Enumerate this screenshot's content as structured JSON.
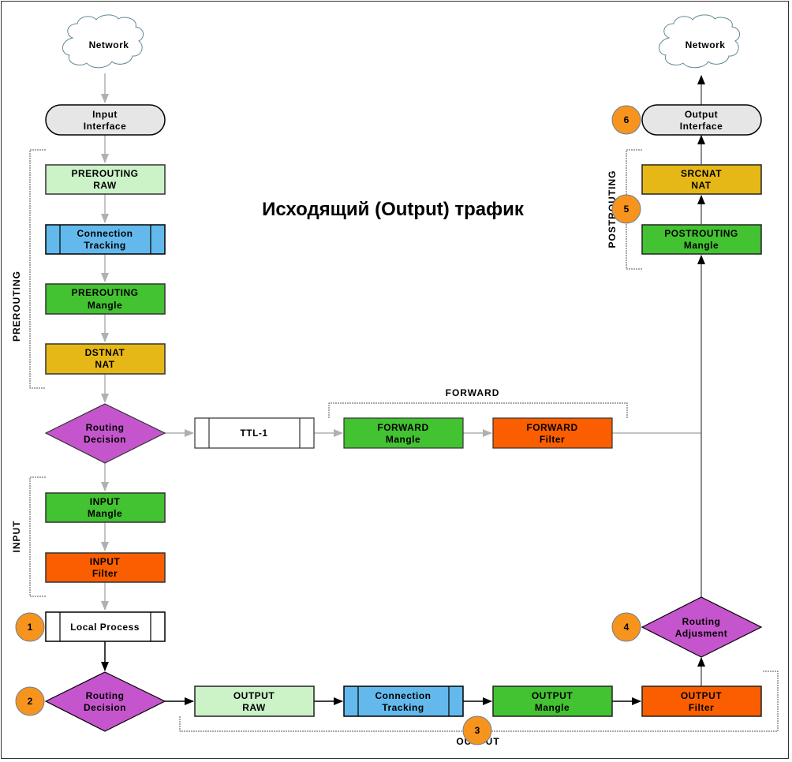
{
  "title": "Исходящий (Output) трафик",
  "colors": {
    "raw": "#ccf2c8",
    "conntrack": "#63b9ec",
    "mangle": "#43c232",
    "nat": "#e6b817",
    "filter": "#fb5e00",
    "decision": "#c555cc",
    "interface": "#e6e6e6",
    "badge": "#f7941d",
    "plain": "#ffffff",
    "arrow_gray": "#b0b0b0",
    "arrow_black": "#000000"
  },
  "groups": {
    "prerouting": "PREROUTING",
    "input": "INPUT",
    "forward": "FORWARD",
    "output": "OUTPUT",
    "postrouting": "POSTROUTING"
  },
  "nodes": {
    "network_in": "Network",
    "input_interface": [
      "Input",
      "Interface"
    ],
    "prerouting_raw": [
      "PREROUTING",
      "RAW"
    ],
    "conntrack_pre": [
      "Connection",
      "Tracking"
    ],
    "prerouting_mangle": [
      "PREROUTING",
      "Mangle"
    ],
    "dstnat": [
      "DSTNAT",
      "NAT"
    ],
    "routing_decision_1": [
      "Routing",
      "Decision"
    ],
    "ttl": "TTL-1",
    "forward_mangle": [
      "FORWARD",
      "Mangle"
    ],
    "forward_filter": [
      "FORWARD",
      "Filter"
    ],
    "input_mangle": [
      "INPUT",
      "Mangle"
    ],
    "input_filter": [
      "INPUT",
      "Filter"
    ],
    "local_process": "Local Process",
    "routing_decision_2": [
      "Routing",
      "Decision"
    ],
    "output_raw": [
      "OUTPUT",
      "RAW"
    ],
    "conntrack_out": [
      "Connection",
      "Tracking"
    ],
    "output_mangle": [
      "OUTPUT",
      "Mangle"
    ],
    "output_filter": [
      "OUTPUT",
      "Filter"
    ],
    "routing_adjustment": [
      "Routing",
      "Adjusment"
    ],
    "postrouting_mangle": [
      "POSTROUTING",
      "Mangle"
    ],
    "srcnat": [
      "SRCNAT",
      "NAT"
    ],
    "output_interface": [
      "Output",
      "Interface"
    ],
    "network_out": "Network"
  },
  "badges": [
    "1",
    "2",
    "3",
    "4",
    "5",
    "6"
  ]
}
